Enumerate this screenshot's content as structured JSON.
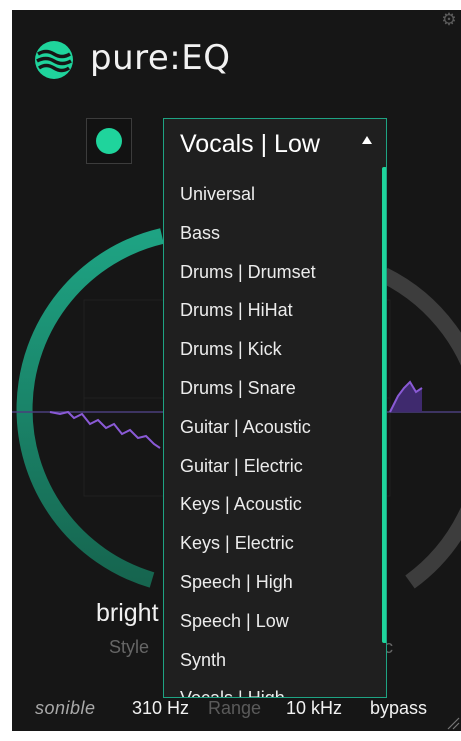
{
  "app": {
    "name": "pure:EQ",
    "power_on": true,
    "accent_color": "#1fd49c"
  },
  "header": {
    "settings_icon": "gear-icon",
    "logo_icon": "sonible-logo-icon"
  },
  "profile_select": {
    "selected": "Vocals | Low",
    "options": [
      "Universal",
      "Bass",
      "Drums | Drumset",
      "Drums | HiHat",
      "Drums | Kick",
      "Drums | Snare",
      "Guitar | Acoustic",
      "Guitar | Electric",
      "Keys | Acoustic",
      "Keys | Electric",
      "Speech | High",
      "Speech | Low",
      "Synth",
      "Vocals | High"
    ]
  },
  "style_knob": {
    "value": "bright",
    "label": "Style",
    "level": 0.55
  },
  "right_knob": {
    "label_partial": "c"
  },
  "footer": {
    "brand": "sonible",
    "range_low": "310 Hz",
    "range_label": "Range",
    "range_high": "10 kHz",
    "bypass": "bypass"
  }
}
